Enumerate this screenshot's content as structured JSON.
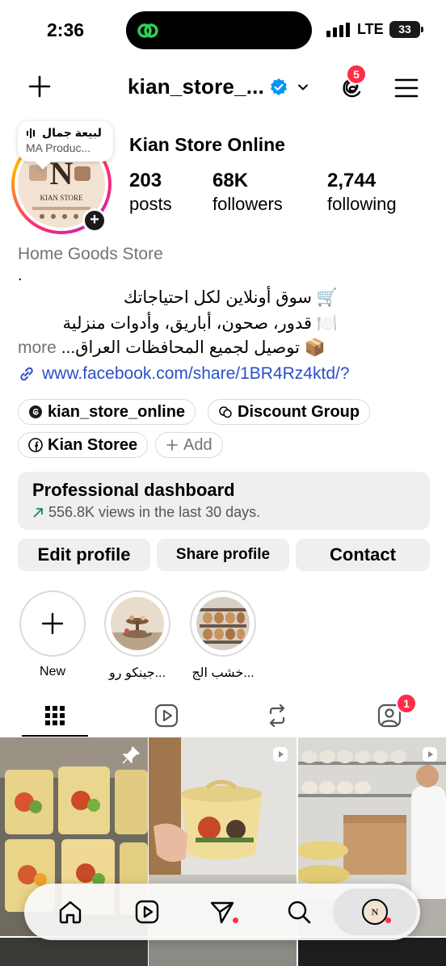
{
  "status_bar": {
    "time": "2:36",
    "network": "LTE",
    "battery": "33"
  },
  "header": {
    "username": "kian_store_...",
    "threads_badge": "5"
  },
  "profile": {
    "music_title": "لبيعة  جمال",
    "music_artist": "MA Produc...",
    "display_name": "Kian Store Online",
    "stats": [
      {
        "value": "203",
        "label": "posts"
      },
      {
        "value": "68K",
        "label": "followers"
      },
      {
        "value": "2,744",
        "label": "following"
      }
    ],
    "category": "Home Goods Store",
    "bio_dot": ".",
    "bio_line1": "🛒 سوق أونلاين لكل احتياجاتك",
    "bio_line2": "🍽️ قدور، صحون، أباريق، وأدوات منزلية",
    "bio_line3": "📦 توصيل لجميع المحافظات العراق...",
    "bio_more": "more",
    "link": "www.facebook.com/share/1BR4Rz4ktd/?",
    "chips": [
      "kian_store_online",
      "Discount Group",
      "Kian Storee",
      "Add"
    ]
  },
  "dashboard": {
    "title": "Professional dashboard",
    "subtitle": "556.8K views in the last 30 days."
  },
  "buttons": {
    "edit": "Edit profile",
    "share": "Share profile",
    "contact": "Contact"
  },
  "highlights": [
    {
      "label": "New"
    },
    {
      "label": "جينكو رو..."
    },
    {
      "label": "خشب الج..."
    }
  ],
  "tabs": {
    "tagged_badge": "1"
  },
  "colors": {
    "accent_link": "#2b4fc8",
    "badge": "#ff2d45",
    "verified": "#0095f6"
  }
}
